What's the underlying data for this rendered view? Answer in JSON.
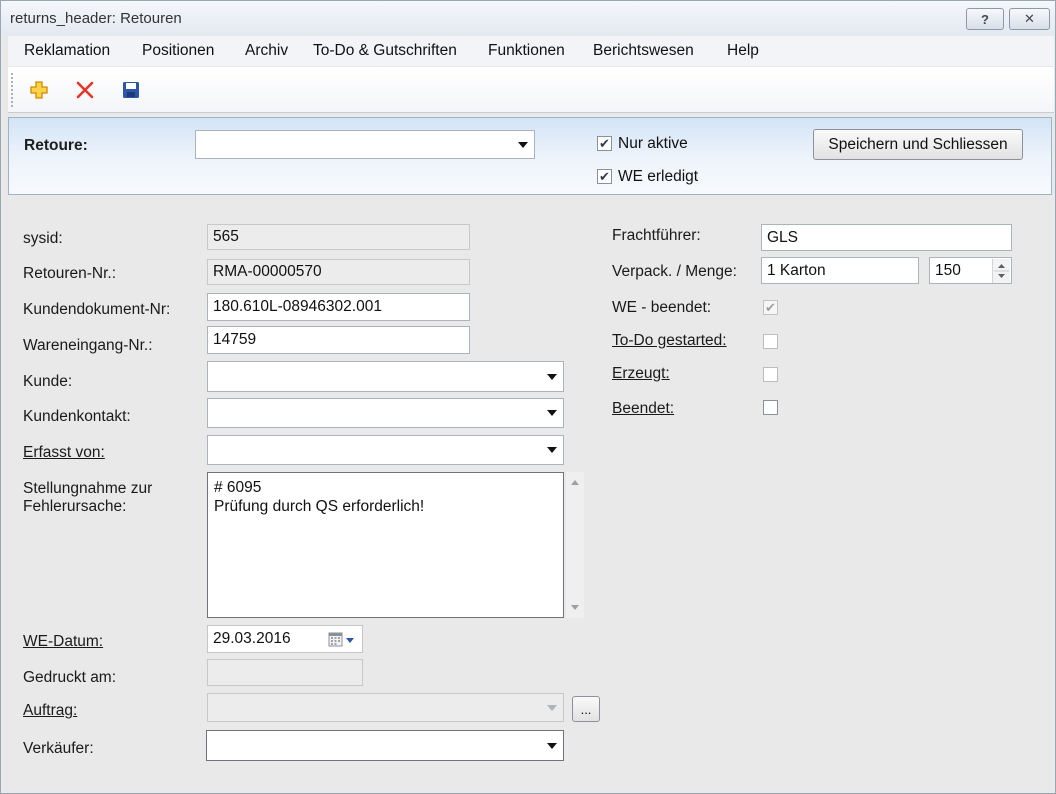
{
  "window": {
    "title": "returns_header: Retouren",
    "help_glyph": "?",
    "close_glyph": "✕"
  },
  "menu": [
    "Reklamation",
    "Positionen",
    "Archiv",
    "To-Do & Gutschriften",
    "Funktionen",
    "Berichtswesen",
    "Help"
  ],
  "toolbar": {
    "icons": [
      "add-icon",
      "delete-icon",
      "save-icon"
    ],
    "colors": {
      "add": "#f2a900",
      "delete": "#e2362b",
      "save": "#2d56a8"
    }
  },
  "header": {
    "retoure_label": "Retoure:",
    "retoure_value": "",
    "nur_aktive_label": "Nur aktive",
    "nur_aktive_checked": true,
    "we_erledigt_label": "WE erledigt",
    "we_erledigt_checked": true,
    "save_close_label": "Speichern und Schliessen"
  },
  "form_left": {
    "sysid_label": "sysid:",
    "sysid_value": "565",
    "retouren_nr_label": "Retouren-Nr.:",
    "retouren_nr_value": "RMA-00000570",
    "kundendokument_label": "Kundendokument-Nr:",
    "kundendokument_value": "180.610L-08946302.001",
    "wareneingang_label": "Wareneingang-Nr.:",
    "wareneingang_value": "14759",
    "kunde_label": "Kunde:",
    "kunde_value": "",
    "kundenkontakt_label": "Kundenkontakt:",
    "kundenkontakt_value": "",
    "erfasst_von_label": "Erfasst von:",
    "erfasst_von_value": "",
    "stellungnahme_label_1": "Stellungnahme zur",
    "stellungnahme_label_2": "Fehlerursache:",
    "stellungnahme_value": "# 6095\nPrüfung durch QS erforderlich!",
    "we_datum_label": "WE-Datum:",
    "we_datum_value": "29.03.2016",
    "gedruckt_label": "Gedruckt am:",
    "gedruckt_value": "",
    "auftrag_label": "Auftrag:",
    "auftrag_value": "",
    "auftrag_button": "...",
    "verkaeufer_label": "Verkäufer:",
    "verkaeufer_value": ""
  },
  "form_right": {
    "frachtfuehrer_label": "Frachtführer:",
    "frachtfuehrer_value": "GLS",
    "verpack_label": "Verpack. / Menge:",
    "verpack_value": "1 Karton",
    "menge_value": "150",
    "we_beendet_label": "WE - beendet:",
    "we_beendet_checked": true,
    "todo_label": "To-Do gestarted:",
    "todo_checked": false,
    "erzeugt_label": "Erzeugt:",
    "erzeugt_checked": false,
    "beendet_label": "Beendet:",
    "beendet_checked": false
  }
}
